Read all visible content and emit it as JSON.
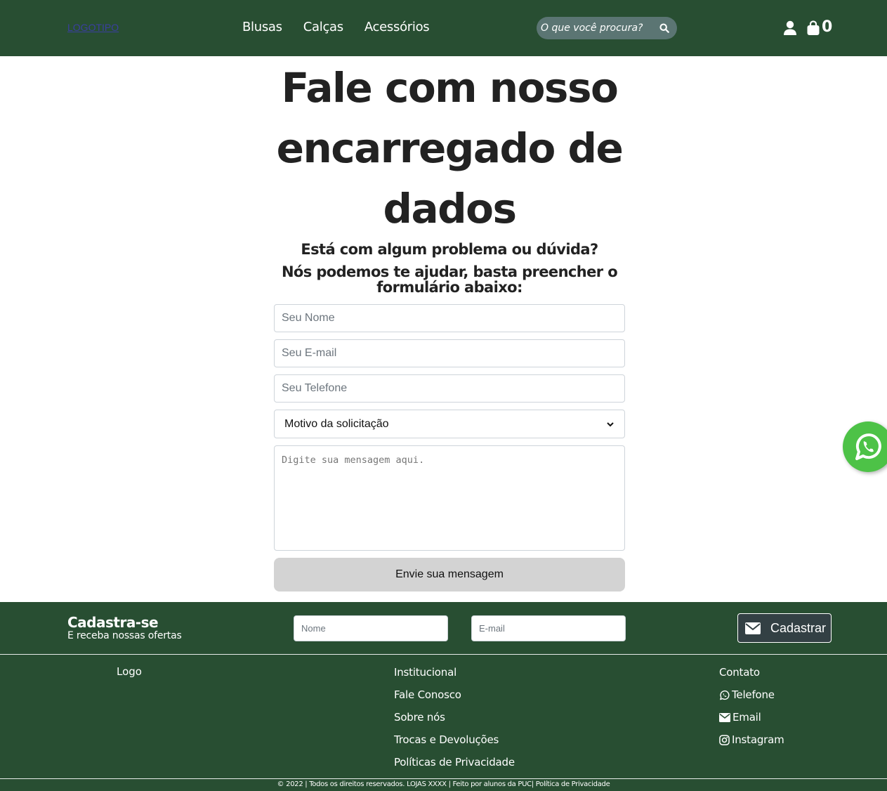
{
  "header": {
    "logo": "LOGOTIPO",
    "nav": [
      "Blusas",
      "Calças",
      "Acessórios"
    ],
    "search_placeholder": "O que você procura?",
    "cart_count": "0"
  },
  "main": {
    "title": "Fale com nosso encarregado de dados",
    "subtitle_line1": "Está com algum problema ou dúvida?",
    "subtitle_line2": "Nós podemos te ajudar, basta preencher o formulário abaixo:",
    "form": {
      "name_placeholder": "Seu Nome",
      "email_placeholder": "Seu E-mail",
      "phone_placeholder": "Seu Telefone",
      "reason_selected": "Motivo da solicitação",
      "message_placeholder": "Digite sua mensagem aqui.",
      "submit_label": "Envie sua mensagem"
    }
  },
  "newsletter": {
    "title": "Cadastra-se",
    "subtitle": "E receba nossas ofertas",
    "name_placeholder": "Nome",
    "email_placeholder": "E-mail",
    "button_label": "Cadastrar"
  },
  "footer": {
    "logo": "Logo",
    "institutional": [
      "Institucional",
      "Fale Conosco",
      "Sobre nós",
      "Trocas e Devoluções",
      "Políticas de Privacidade"
    ],
    "contact": {
      "heading": "Contato",
      "phone": "Telefone",
      "email": "Email",
      "instagram": "Instagram"
    },
    "copyright": "© 2022 | Todos os direitos reservados. LOJAS XXXX | Feito por alunos da PUC| Política de Privacidade"
  },
  "colors": {
    "primary": "#284e32",
    "search_bg": "#5b7573",
    "whatsapp": "#4dc247",
    "submit_bg": "#d3d3d3"
  },
  "icons": [
    "search-icon",
    "user-icon",
    "shopping-bag-icon",
    "whatsapp-icon",
    "envelope-icon",
    "chevron-down-icon",
    "instagram-icon"
  ]
}
